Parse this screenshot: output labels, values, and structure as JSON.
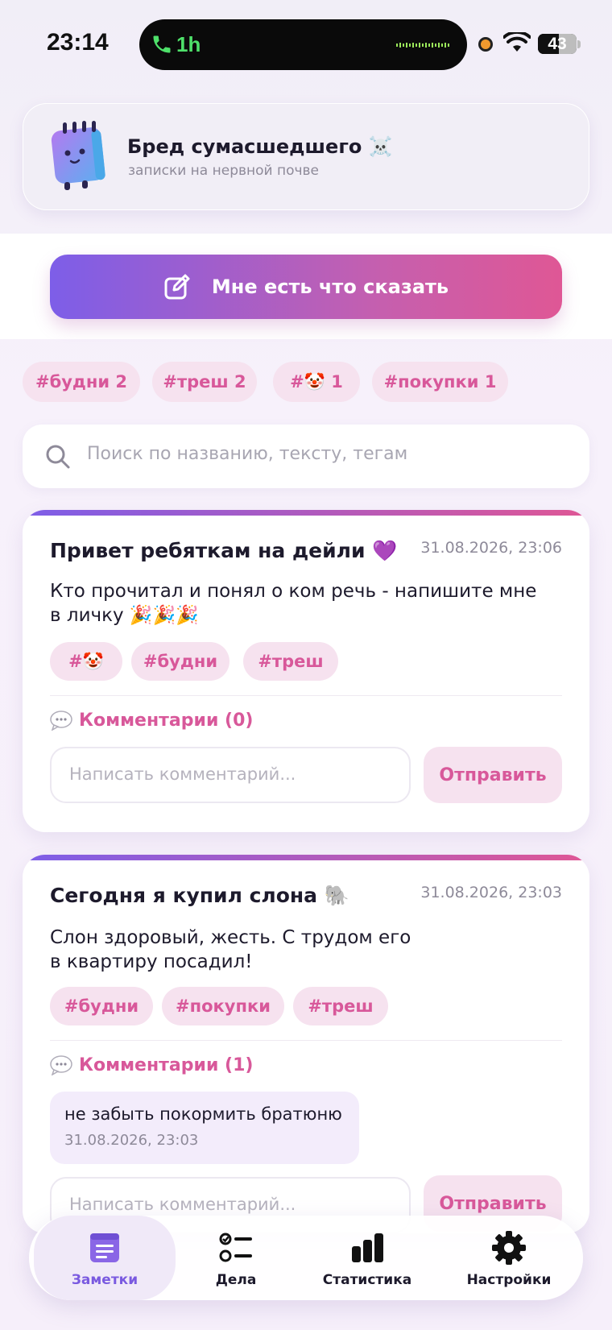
{
  "status_bar": {
    "time": "23:14",
    "call_duration": "1h",
    "battery": "43"
  },
  "header": {
    "title": "Бред сумасшедшего ☠️",
    "subtitle": "записки на нервной почве"
  },
  "actions": {
    "new_note_label": "Мне есть что сказать"
  },
  "tag_filters": [
    {
      "label": "#будни 2"
    },
    {
      "label": "#треш 2"
    },
    {
      "label": "#🤡 1"
    },
    {
      "label": "#покупки 1"
    }
  ],
  "search": {
    "placeholder": "Поиск по названию, тексту, тегам"
  },
  "notes": [
    {
      "title": "Привет ребяткам на дейли 💜",
      "date": "31.08.2026, 23:06",
      "body": "Кто прочитал и понял о ком речь - напишите мне в личку 🎉🎉🎉",
      "tags": [
        "#🤡",
        "#будни",
        "#треш"
      ],
      "comments_label": "Комментарии (0)",
      "comments": [],
      "comment_placeholder": "Написать комментарий...",
      "send_label": "Отправить"
    },
    {
      "title": "Сегодня я купил слона 🐘",
      "date": "31.08.2026, 23:03",
      "body": "Слон здоровый, жесть. С трудом его в квартиру посадил!",
      "tags": [
        "#будни",
        "#покупки",
        "#треш"
      ],
      "comments_label": "Комментарии (1)",
      "comments": [
        {
          "text": "не забыть покормить братюню",
          "date": "31.08.2026, 23:03"
        }
      ],
      "comment_placeholder": "Написать комментарий...",
      "send_label": "Отправить"
    }
  ],
  "nav": [
    {
      "label": "Заметки",
      "icon": "notes-icon",
      "active": true
    },
    {
      "label": "Дела",
      "icon": "checklist-icon",
      "active": false
    },
    {
      "label": "Статистика",
      "icon": "bar-chart-icon",
      "active": false
    },
    {
      "label": "Настройки",
      "icon": "gear-icon",
      "active": false
    }
  ],
  "colors": {
    "accent_pink": "#d8589a",
    "accent_purple": "#7d5ee8",
    "tag_bg": "#f6e2ef"
  }
}
